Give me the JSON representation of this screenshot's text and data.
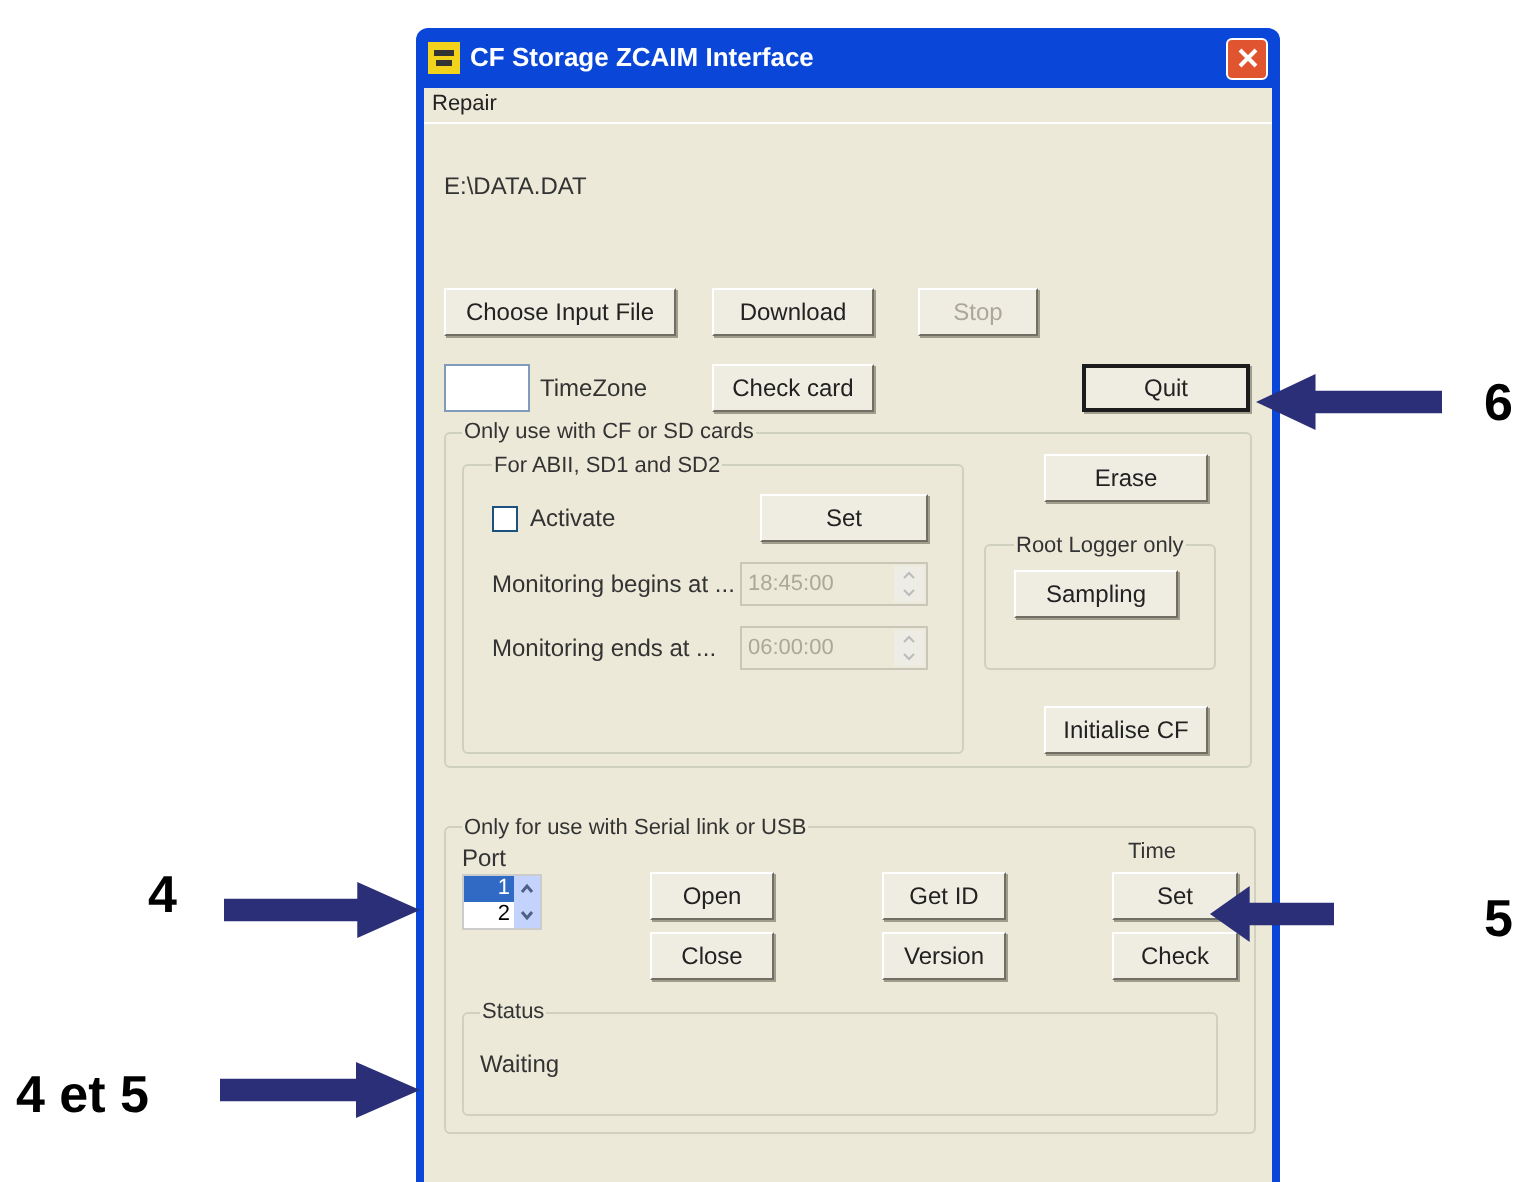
{
  "window": {
    "title": "CF Storage ZCAIM Interface"
  },
  "menu": [
    "Repair"
  ],
  "file_path": "E:\\DATA.DAT",
  "top_buttons": [
    {
      "label": "Choose Input File",
      "disabled": false
    },
    {
      "label": "Download",
      "disabled": false
    },
    {
      "label": "Stop",
      "disabled": true
    }
  ],
  "timezone": {
    "label": "TimeZone"
  },
  "check_card": {
    "label": "Check card",
    "disabled": false
  },
  "quit": {
    "label": "Quit",
    "default": true
  },
  "cf_group": {
    "title": "Only use with CF or SD cards",
    "inner_group": {
      "title": "For ABII, SD1 and SD2",
      "activate": {
        "label": "Activate",
        "checked": false
      },
      "set": {
        "label": "Set"
      },
      "times": [
        {
          "label": "Monitoring begins at ...",
          "value": "18:45:00",
          "disabled": true
        },
        {
          "label": "Monitoring ends at ...",
          "value": "06:00:00",
          "disabled": true
        }
      ]
    },
    "erase": {
      "label": "Erase"
    },
    "root_group": {
      "title": "Root Logger only",
      "button": "Sampling"
    },
    "initialise": {
      "label": "Initialise CF"
    }
  },
  "serial_group": {
    "title": "Only for use with Serial link or USB",
    "port": {
      "label": "Port",
      "items": [
        {
          "label": "1",
          "selected": true
        },
        {
          "label": "2",
          "selected": false
        }
      ]
    },
    "buttons_col1": [
      "Open",
      "Close"
    ],
    "buttons_col2": [
      "Get ID",
      "Version"
    ],
    "time": {
      "label": "Time",
      "buttons": [
        "Set",
        "Check"
      ]
    },
    "status": {
      "title": "Status",
      "text": "Waiting"
    }
  },
  "annotations": [
    {
      "label": "6",
      "kind": "left"
    },
    {
      "label": "4",
      "kind": "right"
    },
    {
      "label": "5",
      "kind": "left"
    },
    {
      "label": "4 et 5",
      "kind": "right"
    }
  ]
}
